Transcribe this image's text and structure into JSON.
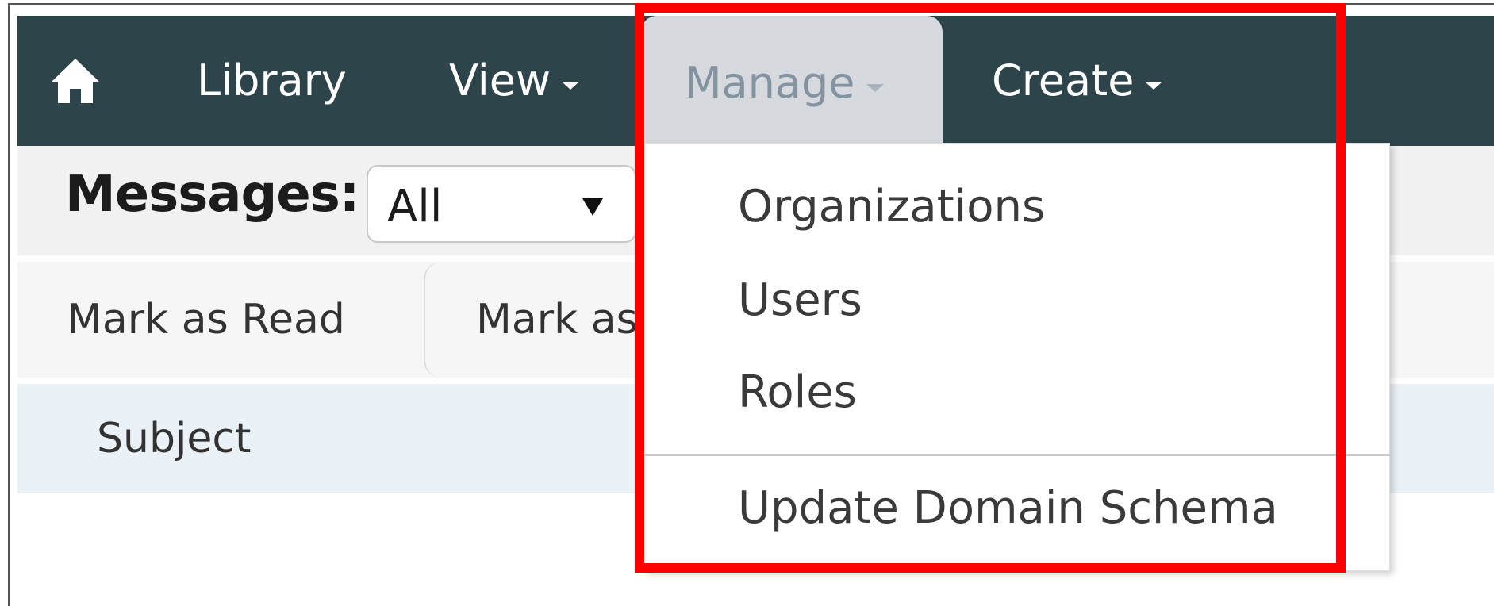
{
  "nav": {
    "home_icon": "home-icon",
    "library": "Library",
    "view": "View",
    "manage": "Manage",
    "create": "Create"
  },
  "messages": {
    "label": "Messages:",
    "filter_value": "All"
  },
  "actions": {
    "mark_read": "Mark as Read",
    "mark_unread": "Mark as Unread"
  },
  "table": {
    "columns": [
      "Subject"
    ]
  },
  "manage_menu": {
    "items": [
      "Organizations",
      "Users",
      "Roles",
      "Update Domain Schema"
    ]
  },
  "colors": {
    "navbar": "#2c444a",
    "highlight": "#ff0000"
  }
}
